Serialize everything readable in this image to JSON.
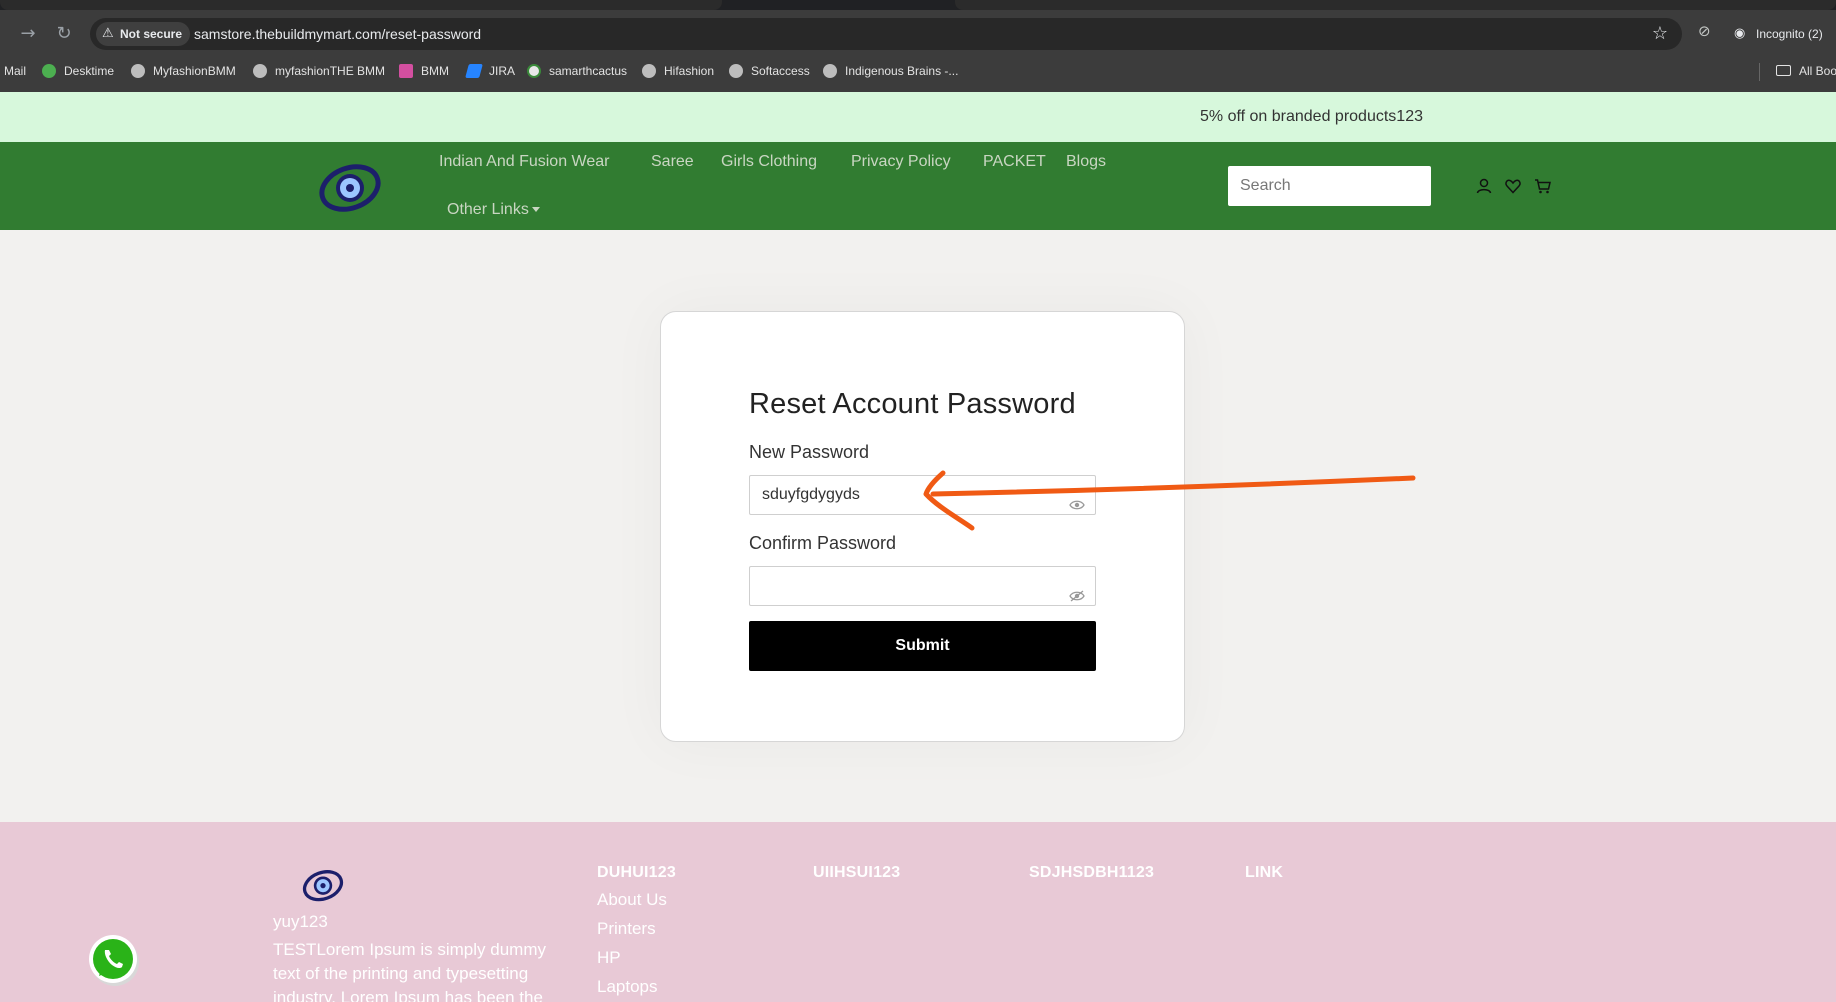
{
  "browser": {
    "security_label": "Not secure",
    "url": "samstore.thebuildmymart.com/reset-password",
    "profile_label": "Incognito (2)",
    "bookmarks": [
      "Mail",
      "Desktime",
      "MyfashionBMM",
      "myfashionTHE BMM",
      "BMM",
      "JIRA",
      "samarthcactus",
      "Hifashion",
      "Softaccess",
      "Indigenous Brains -..."
    ],
    "all_bookmarks_label": "All Boo"
  },
  "announcement": {
    "text": "5% off on branded products123"
  },
  "header": {
    "nav": [
      "Indian And Fusion Wear",
      "Saree",
      "Girls Clothing",
      "Privacy Policy",
      "PACKET",
      "Blogs"
    ],
    "other_links": "Other Links",
    "search_placeholder": "Search"
  },
  "form": {
    "title": "Reset Account Password",
    "new_password_label": "New Password",
    "new_password_value": "sduyfgdygyds",
    "confirm_password_label": "Confirm Password",
    "confirm_password_value": "",
    "submit_label": "Submit"
  },
  "footer": {
    "brand": "yuy123",
    "description": "TESTLorem Ipsum is simply dummy text of the printing and typesetting industry. Lorem Ipsum has been the",
    "columns": [
      {
        "heading": "DUHUI123",
        "links": [
          "About Us",
          "Printers",
          "HP",
          "Laptops"
        ]
      },
      {
        "heading": "UIIHSUI123",
        "links": []
      },
      {
        "heading": "SDJHSDBH1123",
        "links": []
      },
      {
        "heading": "LINK",
        "links": []
      }
    ]
  },
  "colors": {
    "header_green": "#317c31",
    "announcement_bg": "#d7f8dc",
    "footer_pink": "#e8c9d6",
    "annotation_arrow": "#f05a14",
    "submit_bg": "#000000"
  }
}
